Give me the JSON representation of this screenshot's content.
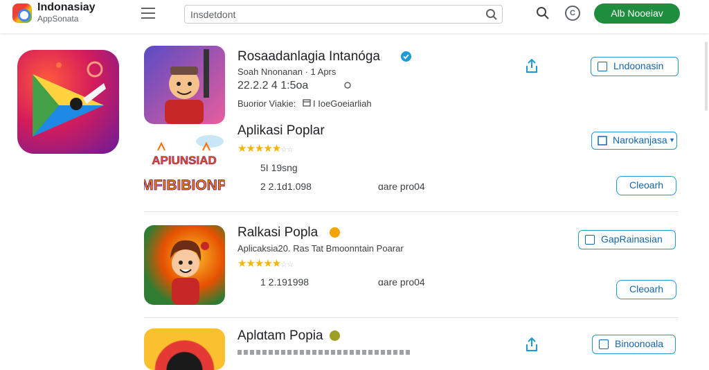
{
  "header": {
    "brand_title": "Indonasiay",
    "brand_subtitle": "AppSonata",
    "search_value": "Insdetdont",
    "refresh_glyph": "C",
    "install_label": "Alb Nooeiav"
  },
  "apps": [
    {
      "title": "Rosaadanlagia Intanóga",
      "subtitle": "Soah Nnonanan · 1 Aprs",
      "meta": "22.2.2 4 1:5oa",
      "extra": "Buorior Viakie:",
      "extra2": "I IoeGoeiarliah",
      "button_label": "Lndoonasin"
    },
    {
      "title": "Aplikasi Poplar",
      "stars": "★★★★★",
      "half": "☆☆",
      "downloads": "5I 19sng",
      "meta": "2 2.1d1.098",
      "price": "ɑare pro04",
      "dropdown_label": "Narokanjasa",
      "button_label": "Cleoarh",
      "banner_top": "APIUNSIAD",
      "banner_bottom": "MFIBIBIONP"
    },
    {
      "title": "Ralkasi Popla",
      "subtitle": "Aplicaksia20. Ras Tat Bmoonntain Poarar",
      "stars": "★★★★★",
      "half": "☆☆",
      "meta": "1 2.191998",
      "price": "ɑare pro04",
      "top_button_label": "GapRainasian",
      "button_label": "Cleoarh"
    },
    {
      "title": "Aplɑtam Popia",
      "button_label": "Binoonoala"
    }
  ],
  "colors": {
    "accent_green": "#1e8e3e",
    "accent_blue": "#1a9ad6",
    "star": "#f4b400"
  }
}
